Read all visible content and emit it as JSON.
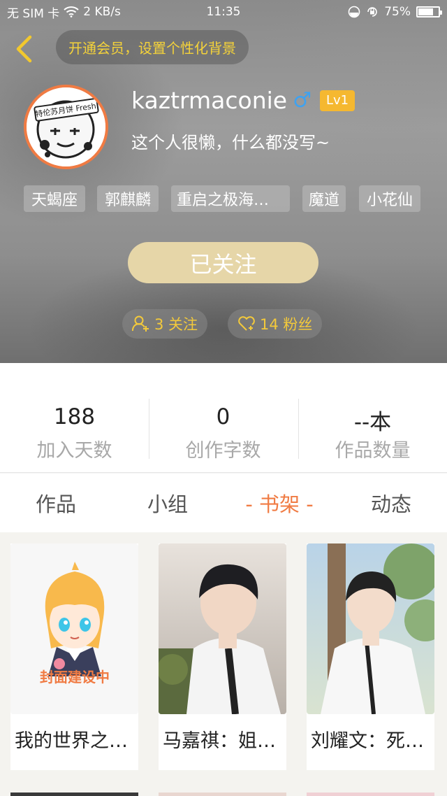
{
  "status_bar": {
    "carrier": "无 SIM 卡",
    "speed": "2 KB/s",
    "time": "11:35",
    "battery": "75%",
    "battery_level": 0.75
  },
  "header": {
    "vip_banner": "开通会员，设置个性化背景",
    "avatar_text": "特伦苏月饼 Fresh",
    "username": "kaztrmaconie",
    "gender_symbol": "♂",
    "level": "Lv1",
    "bio": "这个人很懒，什么都没写~",
    "tags": [
      "天蝎座",
      "郭麒麟",
      "重启之极海…",
      "魔道",
      "小花仙"
    ],
    "follow_button": "已关注",
    "following": "3 关注",
    "fans": "14 粉丝"
  },
  "stats": [
    {
      "value": "188",
      "label": "加入天数"
    },
    {
      "value": "0",
      "label": "创作字数"
    },
    {
      "value": "--本",
      "label": "作品数量"
    }
  ],
  "tabs": [
    {
      "label": "作品",
      "active": false
    },
    {
      "label": "小组",
      "active": false
    },
    {
      "label": "- 书架 -",
      "active": true
    },
    {
      "label": "动态",
      "active": false
    }
  ],
  "books": [
    {
      "title": "我的世界之…",
      "cover_text": "封面建设中"
    },
    {
      "title": "马嘉祺：姐…"
    },
    {
      "title": "刘耀文：死…"
    }
  ],
  "colors": {
    "accent": "#f07b43",
    "vip_text": "#f4d23a",
    "follow_button": "#e6d6a8",
    "gender": "#3fa2f0",
    "level_badge": "#f5b830"
  }
}
